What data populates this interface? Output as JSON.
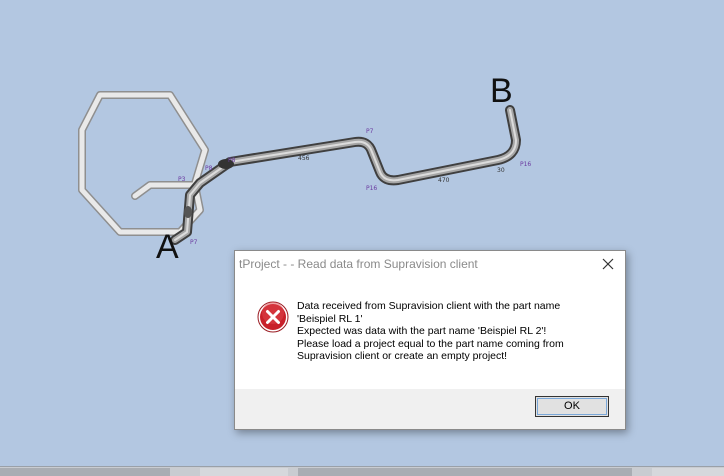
{
  "viewport": {
    "label_a": "A",
    "label_b": "B",
    "small_labels": [
      "P3",
      "P7",
      "P7",
      "P16",
      "P16",
      "P8",
      "P8"
    ],
    "segment_labels": [
      "456",
      "470",
      "30"
    ]
  },
  "dialog": {
    "title": "tProject -  - Read data from Supravision client",
    "message_lines": [
      "Data received from Supravision client with the part name",
      "'Beispiel RL 1'",
      "Expected was data with the part name 'Beispiel RL 2'!",
      "Please load a project equal to the part name coming from",
      "Supravision client or create an empty project!"
    ],
    "ok_label": "OK",
    "icon": "error-icon",
    "close_icon": "close-icon"
  },
  "colors": {
    "background": "#b3c7e1",
    "error_red": "#c8202a",
    "pipe_dark": "#555555",
    "pipe_light": "#cfcfcf"
  }
}
